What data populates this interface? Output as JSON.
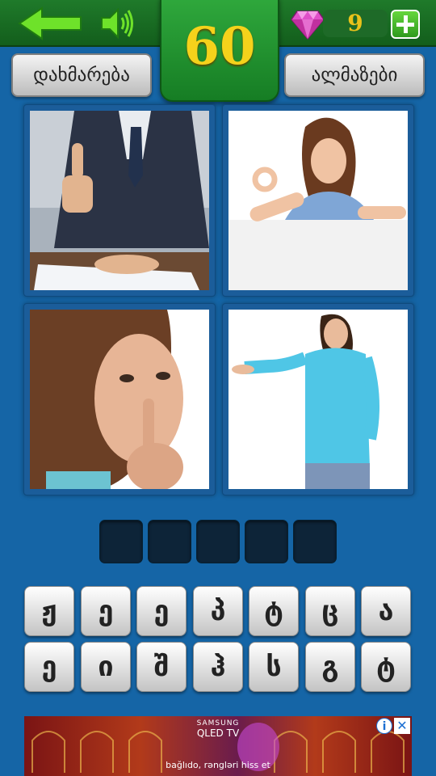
{
  "header": {
    "level": "60",
    "gem_count": "9",
    "back_icon": "arrow-left-icon",
    "sound_icon": "speaker-icon",
    "gem_icon": "diamond-icon",
    "add_icon": "plus-icon"
  },
  "buttons": {
    "hint_label": "დახმარება",
    "gems_label": "ალმაზები"
  },
  "puzzle": {
    "pictures": [
      "man-thumbs-up",
      "woman-ok-gesture",
      "woman-shush-gesture",
      "woman-presenting-gesture"
    ],
    "answer_slots": 5
  },
  "keyboard": {
    "row1": [
      "ჟ",
      "ე",
      "ე",
      "პ",
      "ტ",
      "ც",
      "ა"
    ],
    "row2": [
      "ე",
      "ი",
      "შ",
      "ჰ",
      "ს",
      "გ",
      "ტ"
    ]
  },
  "ad": {
    "brand": "SAMSUNG",
    "product": "QLED TV",
    "caption": "bağlıdo, rəngləri hiss et"
  },
  "colors": {
    "background": "#1565a6",
    "topbar": "#1a6e24",
    "level_text": "#f5d21b",
    "accent_green": "#2fa83c"
  }
}
